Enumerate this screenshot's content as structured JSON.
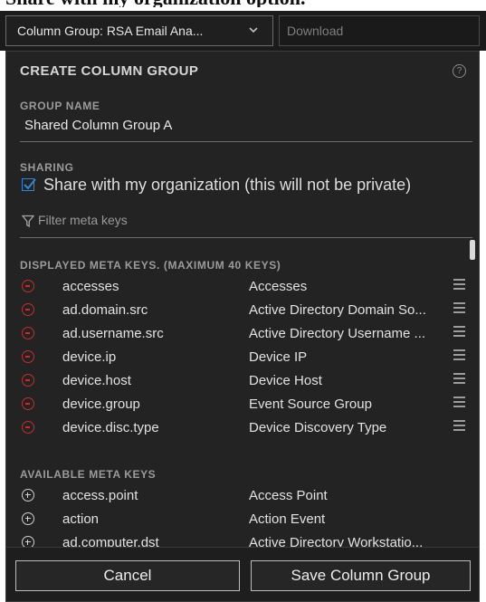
{
  "caption": "Share with my organization option.",
  "toolbar": {
    "column_group_value": "Column Group: RSA Email Ana...",
    "download_placeholder": "Download"
  },
  "panel": {
    "title": "CREATE COLUMN GROUP",
    "help_icon": "?",
    "group_name_label": "GROUP NAME",
    "group_name_value": "Shared Column Group A",
    "sharing_label": "SHARING",
    "share_checked": true,
    "share_text": "Share with my organization (this will not be private)",
    "filter_placeholder": "Filter meta keys",
    "displayed_label": "DISPLAYED META KEYS. (MAXIMUM 40 KEYS)",
    "displayed_keys": [
      {
        "key": "accesses",
        "name": "Accesses"
      },
      {
        "key": "ad.domain.src",
        "name": "Active Directory Domain So..."
      },
      {
        "key": "ad.username.src",
        "name": "Active Directory Username ..."
      },
      {
        "key": "device.ip",
        "name": "Device IP"
      },
      {
        "key": "device.host",
        "name": "Device Host"
      },
      {
        "key": "device.group",
        "name": "Event Source Group"
      },
      {
        "key": "device.disc.type",
        "name": "Device Discovery Type"
      }
    ],
    "available_label": "AVAILABLE META KEYS",
    "available_keys": [
      {
        "key": "access.point",
        "name": "Access Point"
      },
      {
        "key": "action",
        "name": "Action Event"
      },
      {
        "key": "ad.computer.dst",
        "name": "Active Directory Workstatio..."
      }
    ],
    "cancel_label": "Cancel",
    "save_label": "Save Column Group"
  },
  "colors": {
    "panel_bg": "#232323",
    "remove_red": "#c22e2e",
    "checkbox_blue": "#2f86d9"
  },
  "icons": {
    "remove": "minus-circle-icon",
    "add": "plus-circle-icon",
    "drag": "drag-handle-icon",
    "filter": "filter-icon",
    "dropdown": "chevron-down-icon",
    "help": "help-icon",
    "checkbox": "checkbox-checked-icon"
  }
}
